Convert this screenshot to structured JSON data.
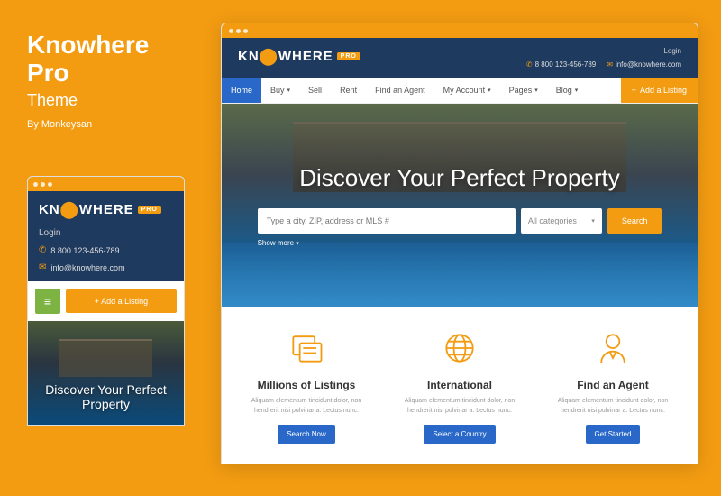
{
  "sidebar": {
    "title1": "Knowhere",
    "title2": "Pro",
    "subtitle": "Theme",
    "byline": "By Monkeysan"
  },
  "logo": {
    "pre": "KN",
    "post": "WHERE",
    "badge": "PRO"
  },
  "mobile": {
    "login": "Login",
    "phone": "8 800 123-456-789",
    "email": "info@knowhere.com",
    "add": "Add a Listing",
    "hero": "Discover Your Perfect Property"
  },
  "desktop": {
    "login": "Login",
    "phone": "8 800 123-456-789",
    "email": "info@knowhere.com",
    "nav": {
      "home": "Home",
      "buy": "Buy",
      "sell": "Sell",
      "rent": "Rent",
      "agent": "Find an Agent",
      "account": "My Account",
      "pages": "Pages",
      "blog": "Blog"
    },
    "add": "Add a Listing",
    "hero_title": "Discover Your Perfect Property",
    "search_placeholder": "Type a city, ZIP, address or MLS #",
    "categories": "All categories",
    "search_btn": "Search",
    "show_more": "Show more"
  },
  "features": [
    {
      "title": "Millions of Listings",
      "desc": "Aliquam elementum tincidunt dolor, non hendrerit nisi pulvinar a. Lectus nunc.",
      "btn": "Search Now"
    },
    {
      "title": "International",
      "desc": "Aliquam elementum tincidunt dolor, non hendrerit nisi pulvinar a. Lectus nunc.",
      "btn": "Select a Country"
    },
    {
      "title": "Find an Agent",
      "desc": "Aliquam elementum tincidunt dolor, non hendrerit nisi pulvinar a. Lectus nunc.",
      "btn": "Get Started"
    }
  ]
}
